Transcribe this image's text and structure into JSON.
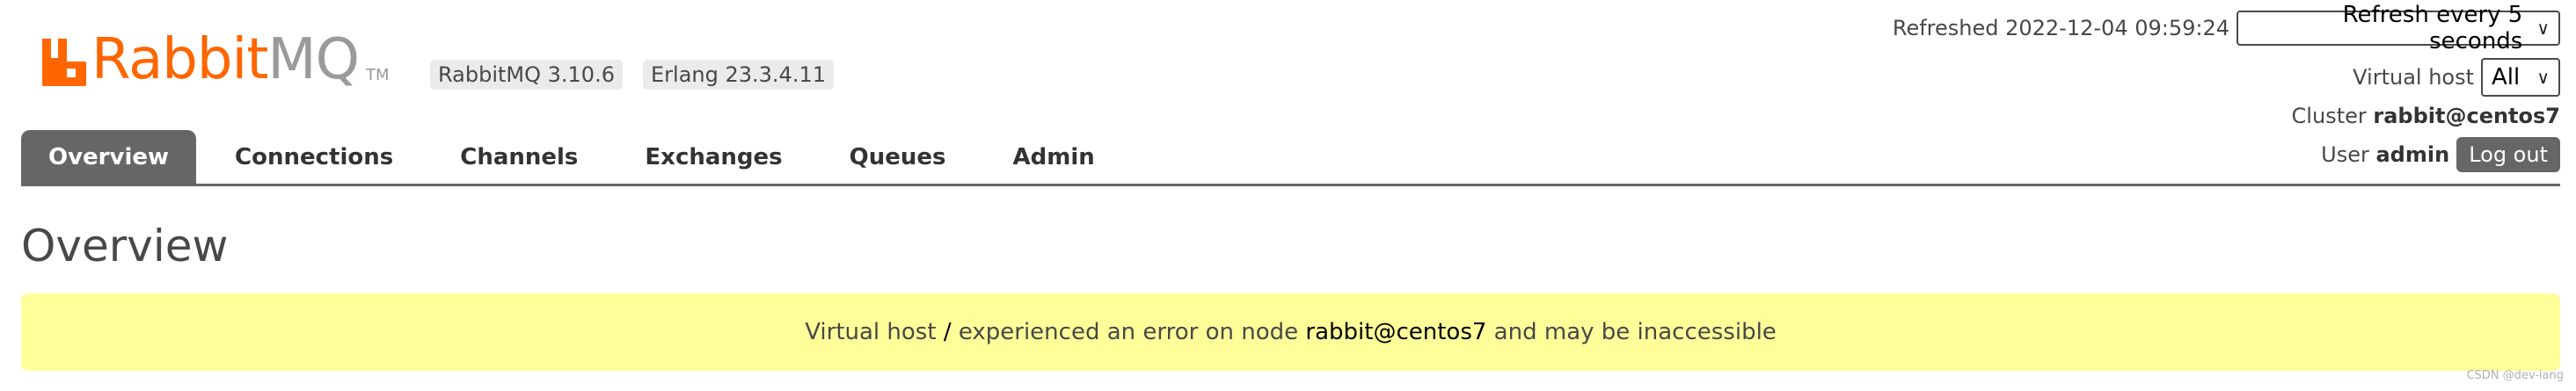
{
  "logo": {
    "text_rabbit": "Rabbit",
    "text_mq": "MQ",
    "tm": "TM",
    "colors": {
      "orange": "#ff6600",
      "gray": "#9a9a9a"
    }
  },
  "badges": {
    "rabbitmq_version": "RabbitMQ 3.10.6",
    "erlang_version": "Erlang 23.3.4.11"
  },
  "header": {
    "refreshed_label": "Refreshed 2022-12-04 09:59:24",
    "refresh_select_value": "Refresh every 5 seconds",
    "virtual_host_label": "Virtual host",
    "virtual_host_value": "All",
    "cluster_label": "Cluster",
    "cluster_value": "rabbit@centos7",
    "user_label": "User",
    "user_value": "admin",
    "logout_label": "Log out"
  },
  "tabs": [
    {
      "label": "Overview",
      "active": true
    },
    {
      "label": "Connections",
      "active": false
    },
    {
      "label": "Channels",
      "active": false
    },
    {
      "label": "Exchanges",
      "active": false
    },
    {
      "label": "Queues",
      "active": false
    },
    {
      "label": "Admin",
      "active": false
    }
  ],
  "page_title": "Overview",
  "warning": {
    "prefix": "Virtual host ",
    "vhost": "/",
    "middle": " experienced an error on node ",
    "node": "rabbit@centos7",
    "suffix": " and may be inaccessible",
    "background": "#ffff99"
  },
  "watermark": "CSDN @dev-lang"
}
